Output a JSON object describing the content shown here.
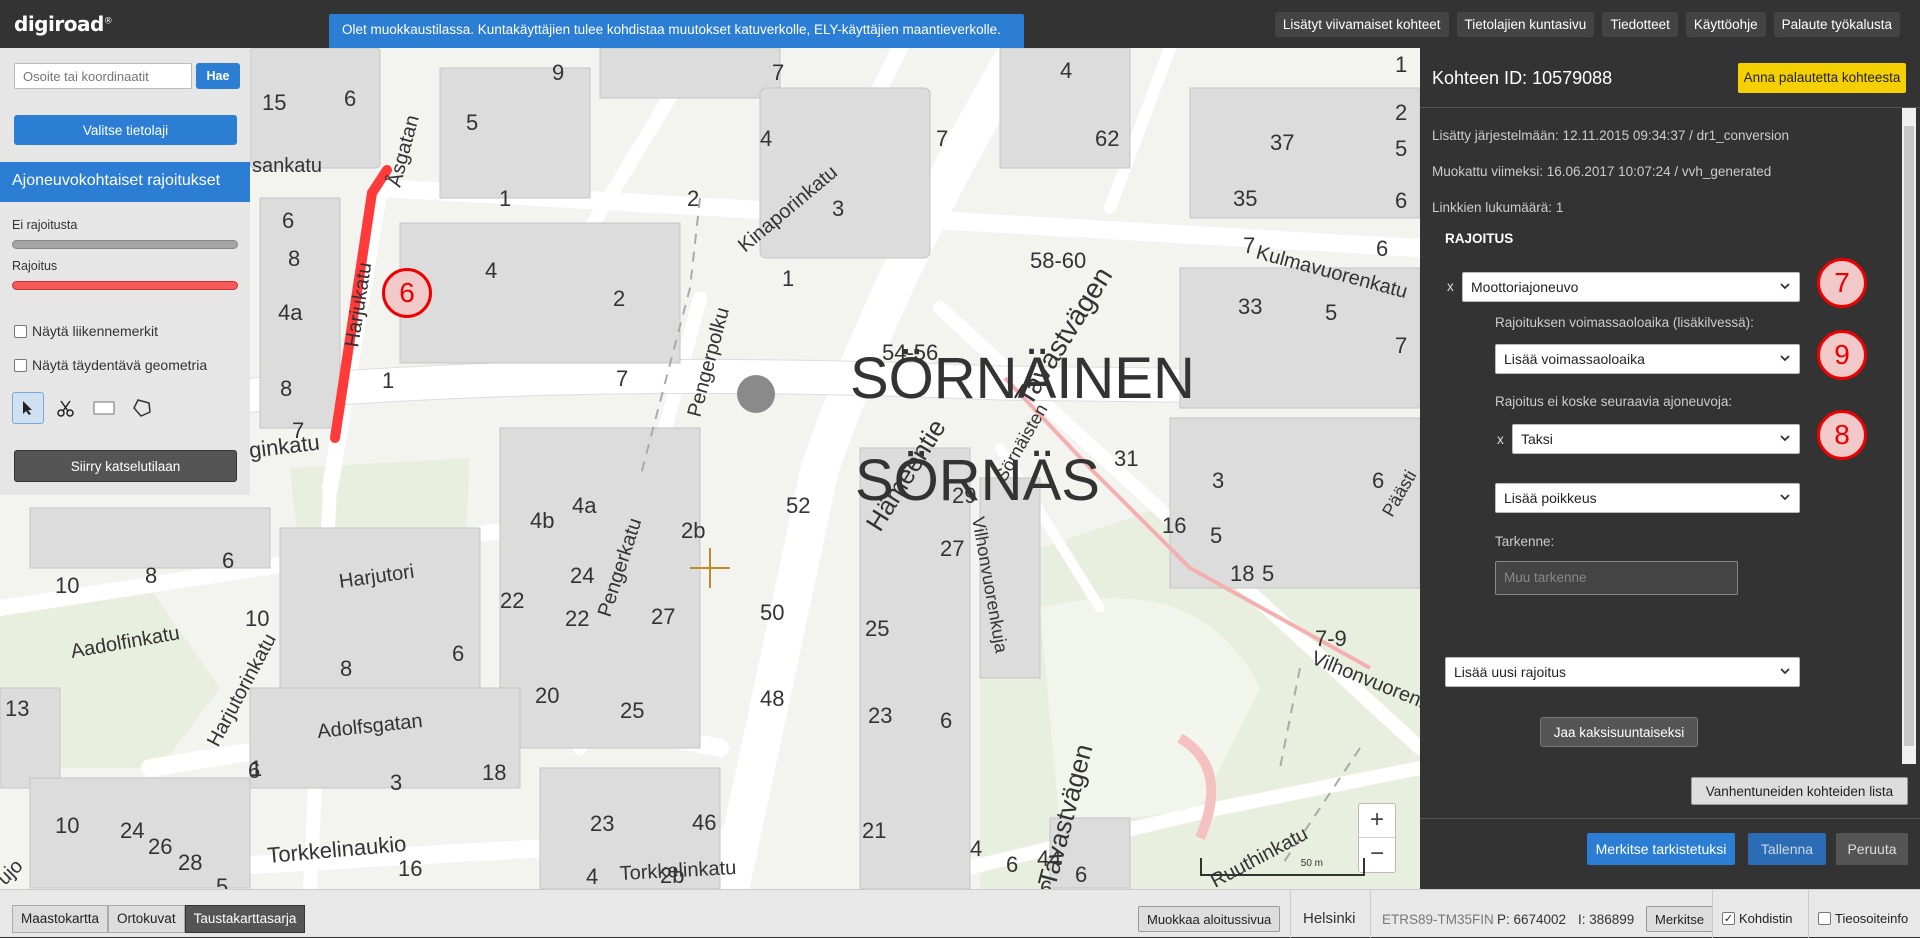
{
  "app": {
    "logo": "digiroad",
    "logo_mark": "®"
  },
  "notice": "Olet muokkaustilassa. Kuntakäyttäjien tulee kohdistaa muutokset katuverkolle, ELY-käyttäjien maantieverkolle.",
  "toplinks": [
    "Lisätyt viivamaiset kohteet",
    "Tietolajien kuntasivu",
    "Tiedotteet",
    "Käyttöohje",
    "Palaute työkalusta"
  ],
  "left": {
    "search_placeholder": "Osoite tai koordinaatit",
    "search_button": "Hae",
    "choose_layer": "Valitse tietolaji",
    "layer_title": "Ajoneuvokohtaiset rajoitukset",
    "legend": [
      {
        "label": "Ei rajoitusta",
        "color": "#a5a5a5"
      },
      {
        "label": "Rajoitus",
        "color": "#f55a5a"
      }
    ],
    "checkboxes": [
      "Näytä liikennemerkit",
      "Näytä täydentävä geometria"
    ],
    "tools": [
      "select-tool",
      "cut-tool",
      "rectangle-tool",
      "polygon-tool"
    ],
    "view_mode_button": "Siirry katselutilaan"
  },
  "map": {
    "district_1": "SÖRNÄINEN",
    "district_2": "SÖRNÄS",
    "streets": [
      "Harjukatu",
      "Åsgatan",
      "Kinaporinkatu",
      "Pengerpolku",
      "Pengerkatu",
      "Hämeentie",
      "Tavastvägen",
      "Harjutori",
      "Aadolfinkatu",
      "Adolfsgatan",
      "Harjutorinkatu",
      "Torkkelinaukio",
      "Torkkelinkatu",
      "Kulmavuorenkatu",
      "Vilhonvuorenkuja",
      "Vilhonvuorenkatu",
      "Ruuthinkatu",
      "Sörnäisten",
      "sankatu",
      "ginkatu",
      "Päästi",
      "ujo"
    ],
    "numbers": [
      "15",
      "6",
      "9",
      "5",
      "4",
      "2",
      "3",
      "7",
      "62",
      "5",
      "37",
      "6",
      "8",
      "4a",
      "6",
      "4",
      "2",
      "1",
      "58-60",
      "35",
      "6",
      "7",
      "1",
      "1",
      "54-56",
      "33",
      "5",
      "7",
      "7",
      "31",
      "3",
      "6",
      "4b",
      "4a",
      "2b",
      "52",
      "29",
      "16",
      "5",
      "10",
      "8",
      "6",
      "22",
      "24",
      "27",
      "50",
      "27",
      "18",
      "5",
      "10",
      "22",
      "20",
      "25",
      "7-9",
      "6",
      "8",
      "48",
      "23",
      "13",
      "25",
      "3",
      "18",
      "1",
      "23",
      "6",
      "10",
      "24",
      "26",
      "28",
      "46",
      "21",
      "4",
      "5",
      "16",
      "4",
      "2b",
      "44",
      "6",
      "6",
      "6",
      "6",
      "1",
      "4",
      "2",
      "6",
      "8",
      "7",
      "7",
      "1"
    ],
    "scale_label": "50 m",
    "zoom_in": "+",
    "zoom_out": "−"
  },
  "panel": {
    "title": "Kohteen ID: 10579088",
    "feedback_button": "Anna palautetta kohteesta",
    "added": "Lisätty järjestelmään: 12.11.2015 09:34:37 / dr1_conversion",
    "modified": "Muokattu viimeksi: 16.06.2017 10:07:24 / vvh_generated",
    "link_count": "Linkkien lukumäärä: 1",
    "section_title": "RAJOITUS",
    "restriction_value": "Moottoriajoneuvo",
    "validity_label": "Rajoituksen voimassaoloaika (lisäkilvessä):",
    "validity_select": "Lisää voimassaoloaika",
    "exceptions_label": "Rajoitus ei koske seuraavia ajoneuvoja:",
    "exception_value": "Taksi",
    "add_exception": "Lisää poikkeus",
    "spec_label": "Tarkenne:",
    "spec_placeholder": "Muu tarkenne",
    "add_restriction": "Lisää uusi rajoitus",
    "split_button": "Jaa kaksisuuntaiseksi",
    "remove_mark": "x",
    "expired_list_button": "Vanhentuneiden kohteiden lista",
    "mark_checked_button": "Merkitse tarkistetuksi",
    "save_button": "Tallenna",
    "cancel_button": "Peruuta"
  },
  "annotations": {
    "c6": "6",
    "c7": "7",
    "c8": "8",
    "c9": "9"
  },
  "bottom": {
    "basemaps": [
      "Maastokartta",
      "Ortokuvat",
      "Taustakarttasarja"
    ],
    "active_basemap": "Taustakarttasarja",
    "edit_start_page": "Muokkaa aloitussivua",
    "city": "Helsinki",
    "crs": "ETRS89-TM35FIN",
    "p": "P: 6674002",
    "i": "I: 386899",
    "mark_button": "Merkitse",
    "crosshair_label": "Kohdistin",
    "crosshair_checked": true,
    "address_label": "Tieosoiteinfo",
    "address_checked": false
  },
  "colors": {
    "accent": "#2b7ed4",
    "feedback": "#f5d000",
    "restriction": "#f55a5a",
    "no_restriction": "#a5a5a5",
    "panel_bg": "#333333"
  }
}
